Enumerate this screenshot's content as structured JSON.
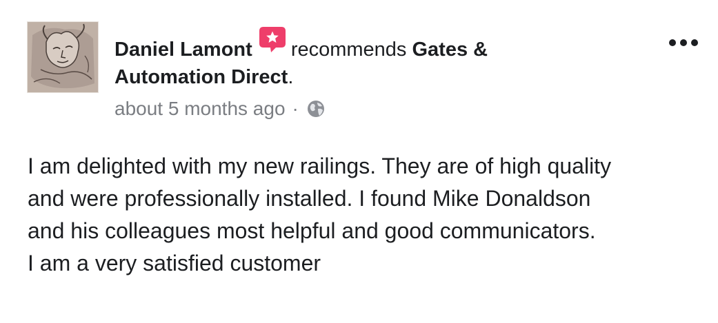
{
  "post": {
    "author": "Daniel Lamont",
    "verb": "recommends",
    "page_line1": "Gates &",
    "page_line2": "Automation Direct",
    "period": ".",
    "timestamp": "about 5 months ago",
    "separator": "·",
    "privacy_icon": "globe-icon",
    "recommend_icon": "recommendation-badge-icon",
    "more_icon": "ellipsis-icon",
    "avatar_icon": "avatar-image",
    "body": "I am delighted with my new railings. They are of high quality\nand were professionally installed. I found Mike Donaldson\nand his colleagues most helpful and good communicators.\nI am a very satisfied customer"
  },
  "colors": {
    "text": "#1c1e21",
    "meta": "#7a7d82",
    "recommend_badge": "#ee3e6a",
    "background": "#ffffff"
  }
}
